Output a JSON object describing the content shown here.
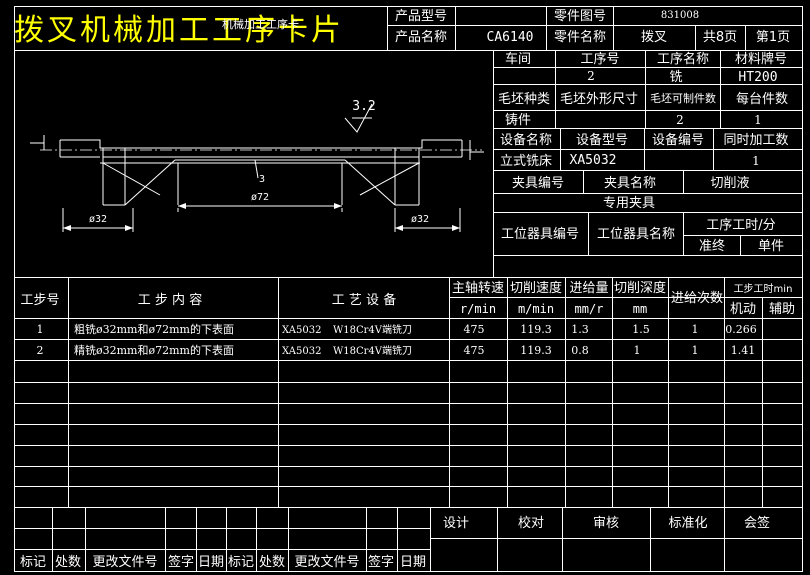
{
  "title": "拨叉机械加工工序卡片",
  "header": {
    "product_model_label": "产品型号",
    "product_name_label": "产品名称",
    "product_name_value": "CA6140",
    "part_drawing_no_label": "零件图号",
    "part_drawing_no_value": "831008",
    "part_name_label": "零件名称",
    "part_name_value": "拨叉",
    "total_pages": "共8页",
    "page_no": "第1页",
    "card_title_small": "机械加工工序卡"
  },
  "info": {
    "workshop_label": "车间",
    "process_no_label": "工序号",
    "process_name_label": "工序名称",
    "material_label": "材料牌号",
    "process_no_value": "2",
    "process_name_value": "铣",
    "material_value": "HT200",
    "blank_type_label": "毛坯种类",
    "blank_size_label": "毛坯外形尺寸",
    "blank_parts_label": "毛坯可制件数",
    "parts_per_machine_label": "每台件数",
    "blank_type_value": "铸件",
    "blank_parts_value": "2",
    "parts_per_machine_value": "1",
    "equipment_name_label": "设备名称",
    "equipment_model_label": "设备型号",
    "equipment_no_label": "设备编号",
    "simultaneous_label": "同时加工数",
    "equipment_name_value": "立式铣床",
    "equipment_model_value": "XA5032",
    "simultaneous_value": "1",
    "fixture_no_label": "夹具编号",
    "fixture_name_label": "夹具名称",
    "coolant_label": "切削液",
    "fixture_name_value": "专用夹具",
    "station_tool_no_label": "工位器具编号",
    "station_tool_name_label": "工位器具名称",
    "process_time_label": "工序工时/分",
    "prep_end_label": "准终",
    "unit_time_label": "单件"
  },
  "drawing": {
    "roughness": "3.2",
    "dim_left": "ø32",
    "dim_center": "ø72",
    "dim_right": "ø32",
    "dim_three": "3"
  },
  "steps_header": {
    "step_no": "工步号",
    "step_content": "工 步 内 容",
    "equipment": "工 艺 设 备",
    "spindle_speed": "主轴转速",
    "cutting_speed": "切削速度",
    "feed": "进给量",
    "depth": "切削深度",
    "passes": "进给次数",
    "step_time": "工步工时min",
    "unit_speed": "r/min",
    "unit_cut": "m/min",
    "unit_feed": "mm/r",
    "unit_depth": "mm",
    "machine_time": "机动",
    "aux_time": "辅助"
  },
  "steps": [
    {
      "no": "1",
      "content": "粗铣ø32mm和ø72mm的下表面",
      "machine": "XA5032",
      "tool": "W18Cr4V端铣刀",
      "speed": "475",
      "cut_speed": "119.3",
      "feed": "1.3",
      "depth": "1.5",
      "passes": "1",
      "machine_time": "0.266"
    },
    {
      "no": "2",
      "content": "精铣ø32mm和ø72mm的下表面",
      "machine": "XA5032",
      "tool": "W18Cr4V端铣刀",
      "speed": "475",
      "cut_speed": "119.3",
      "feed": "0.8",
      "depth": "1",
      "passes": "1",
      "machine_time": "1.41"
    }
  ],
  "signoff": {
    "design": "设计",
    "proofread": "校对",
    "review": "审核",
    "standardize": "标准化",
    "countersign": "会签"
  },
  "revision": {
    "mark": "标记",
    "count": "处数",
    "doc_no": "更改文件号",
    "sign": "签字",
    "date": "日期"
  }
}
